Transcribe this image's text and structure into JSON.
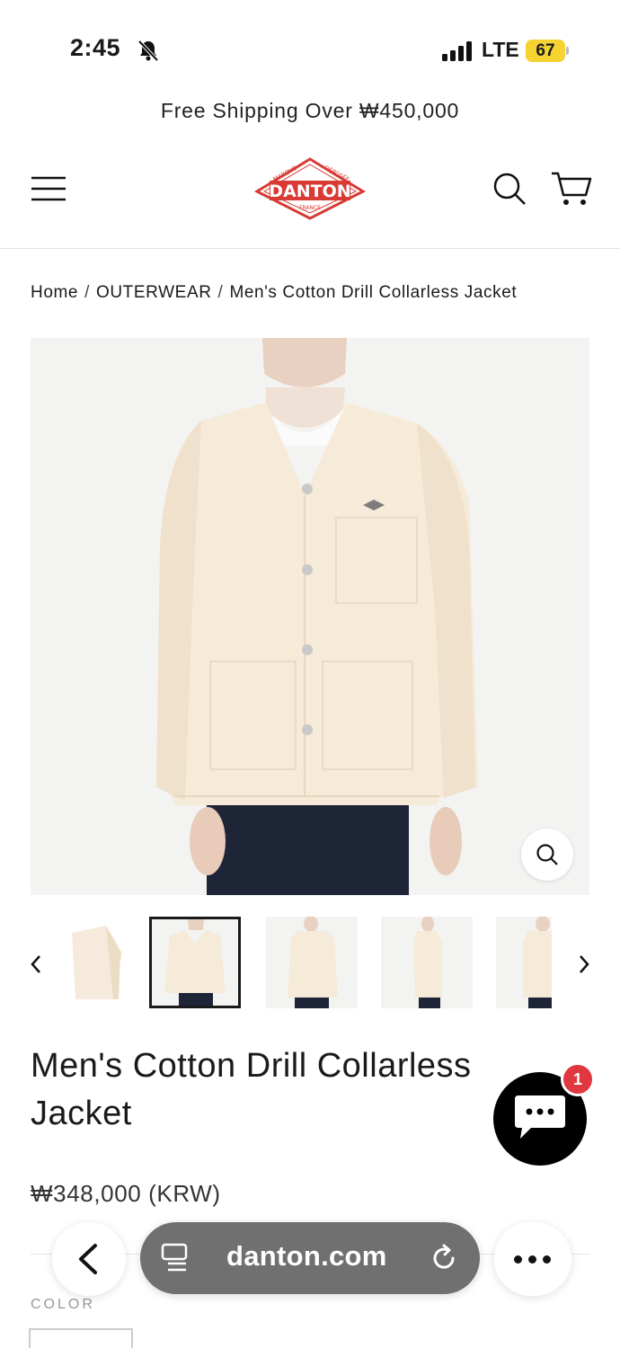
{
  "status_bar": {
    "time": "2:45",
    "network": "LTE",
    "battery": "67"
  },
  "announcement": "Free Shipping Over ₩450,000",
  "header": {
    "logo_text": "DANTON",
    "logo_top_left": "MARQUE",
    "logo_top_right": "DÉPOSÉE",
    "logo_bottom": "FRANCE"
  },
  "breadcrumb": {
    "home": "Home",
    "category": "OUTERWEAR",
    "current": "Men's Cotton Drill Collarless Jacket",
    "separator": "/"
  },
  "product": {
    "title": "Men's Cotton Drill Collarless Jacket",
    "price": "₩348,000 (KRW)",
    "color_label": "COLOR",
    "thumbnails_count": 5,
    "active_thumbnail": 2
  },
  "chat": {
    "badge": "1"
  },
  "browser": {
    "address": "danton.com"
  },
  "colors": {
    "logo_red": "#d93a34",
    "badge_red": "#e0383e",
    "battery_yellow": "#f5d432",
    "jacket_cream": "#f6ead8"
  }
}
